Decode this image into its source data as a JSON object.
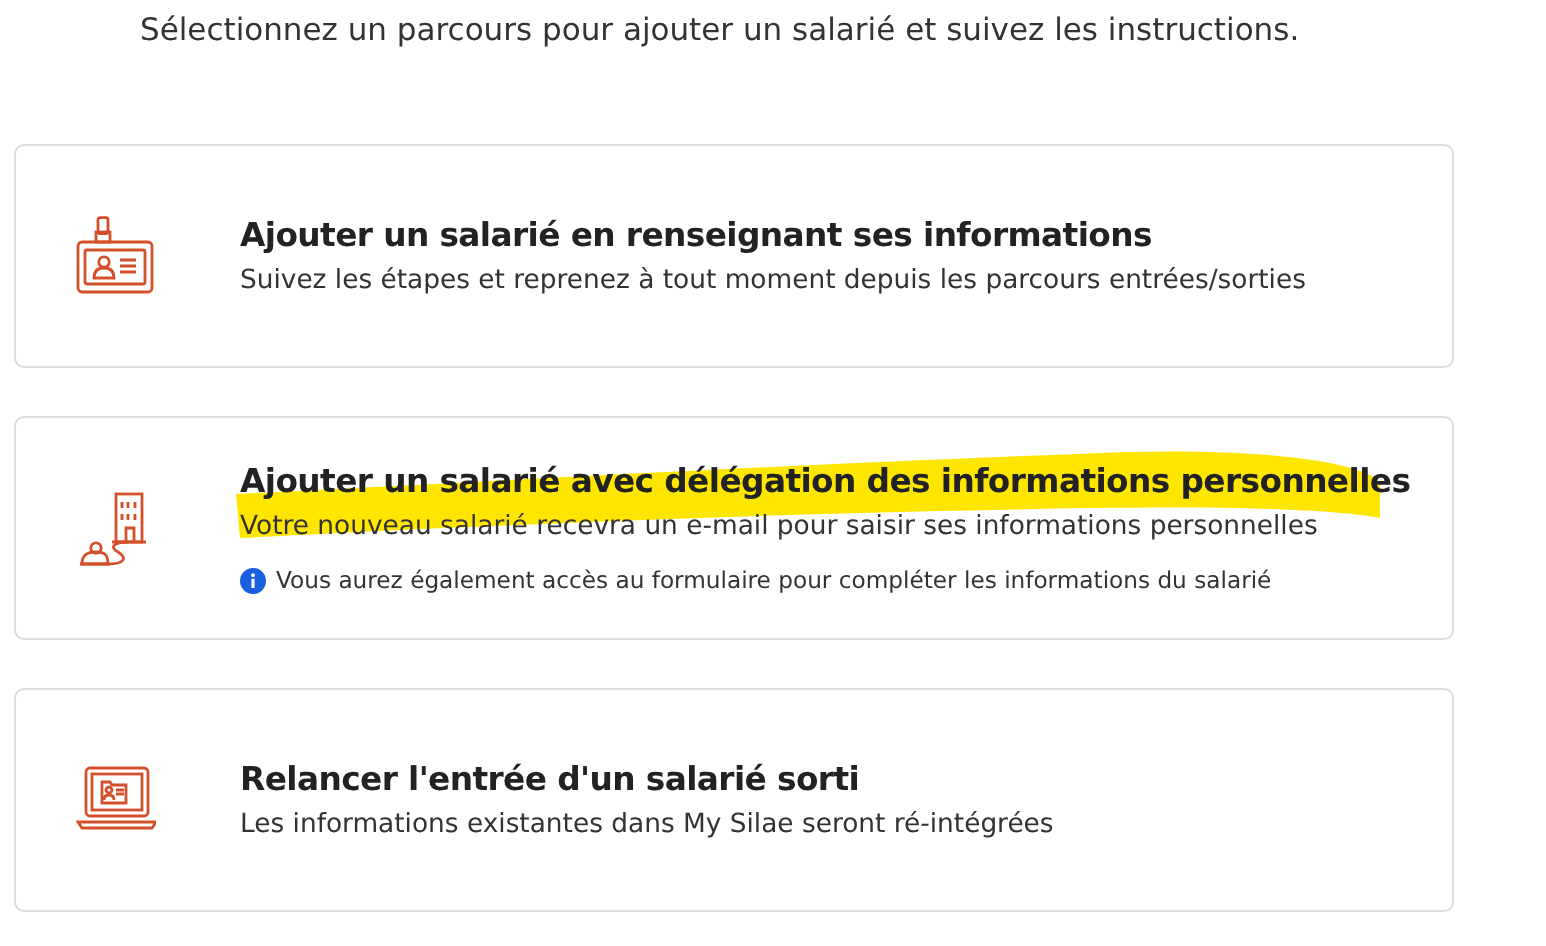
{
  "intro": "Sélectionnez un parcours pour ajouter un salarié et suivez les instructions.",
  "cards": [
    {
      "kind": "badge",
      "title": "Ajouter un salarié en renseignant ses informations",
      "description": "Suivez les étapes et reprenez à tout moment depuis les parcours entrées/sorties",
      "highlighted": false
    },
    {
      "kind": "building",
      "title": "Ajouter un salarié avec délégation des informations personnelles",
      "description": "Votre nouveau salarié recevra un e-mail pour saisir ses informations personnelles",
      "note": "Vous aurez également accès au formulaire pour compléter les informations du salarié",
      "highlighted": true
    },
    {
      "kind": "laptop",
      "title": "Relancer l'entrée d'un salarié sorti",
      "description": "Les informations existantes dans My Silae seront ré-intégrées",
      "highlighted": false
    }
  ]
}
